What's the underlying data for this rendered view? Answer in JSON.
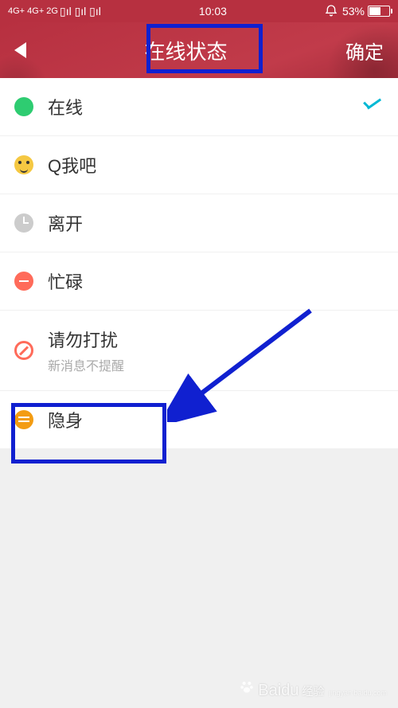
{
  "status_bar": {
    "network": "4G+ 4G+ 2G",
    "time": "10:03",
    "alarm_icon": "alarm",
    "battery_percent": "53%"
  },
  "header": {
    "title": "在线状态",
    "confirm": "确定"
  },
  "status_options": [
    {
      "label": "在线",
      "sublabel": "",
      "selected": true,
      "icon": "online"
    },
    {
      "label": "Q我吧",
      "sublabel": "",
      "selected": false,
      "icon": "qme"
    },
    {
      "label": "离开",
      "sublabel": "",
      "selected": false,
      "icon": "away"
    },
    {
      "label": "忙碌",
      "sublabel": "",
      "selected": false,
      "icon": "busy"
    },
    {
      "label": "请勿打扰",
      "sublabel": "新消息不提醒",
      "selected": false,
      "icon": "dnd"
    },
    {
      "label": "隐身",
      "sublabel": "",
      "selected": false,
      "icon": "invisible"
    }
  ],
  "watermark": {
    "main": "Baidu",
    "sub": "经验",
    "url": "jingyan.baidu.com"
  }
}
